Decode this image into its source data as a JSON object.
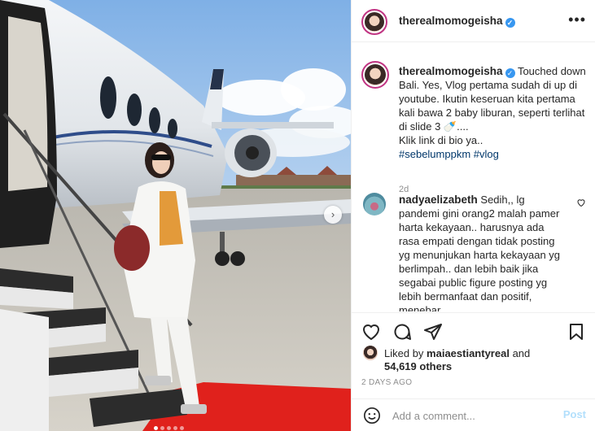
{
  "post": {
    "username": "therealmomogeisha",
    "verified_mark": "✓",
    "more_icon": "more-options-icon",
    "caption": {
      "username": "therealmomogeisha",
      "text": "Touched down Bali. Yes, Vlog pertama sudah di up di youtube. Ikutin keseruan kita pertama kali bawa 2 baby liburan, seperti terlihat di slide 3 🍼....",
      "line2": "Klik link di bio ya..",
      "hashtags": "#sebelumppkm #vlog",
      "age": "2d"
    },
    "comments": [
      {
        "username": "nadyaelizabeth",
        "text": "Sedih,, lg pandemi gini orang2 malah pamer harta kekayaan.. harusnya ada rasa empati dengan tidak posting yg menunjukan harta kekayaan yg berlimpah.. dan lebih baik jika segabai public figure posting yg lebih bermanfaat dan positif, menebar"
      }
    ],
    "actions": [
      "like-icon",
      "comment-icon",
      "share-icon",
      "save-icon"
    ],
    "likes": {
      "prefix": "Liked by",
      "user": "maiaestiantyreal",
      "joiner": "and",
      "count": "54,619 others"
    },
    "posted_time": "2 DAYS AGO",
    "add_comment": {
      "placeholder": "Add a comment...",
      "post_label": "Post"
    },
    "carousel": {
      "next_glyph": "›",
      "slides": 5,
      "active_slide": 1
    },
    "colors": {
      "link": "#00376b",
      "verified": "#3897f0",
      "post_button": "#b2dffc",
      "muted": "#8e8e8e"
    }
  }
}
